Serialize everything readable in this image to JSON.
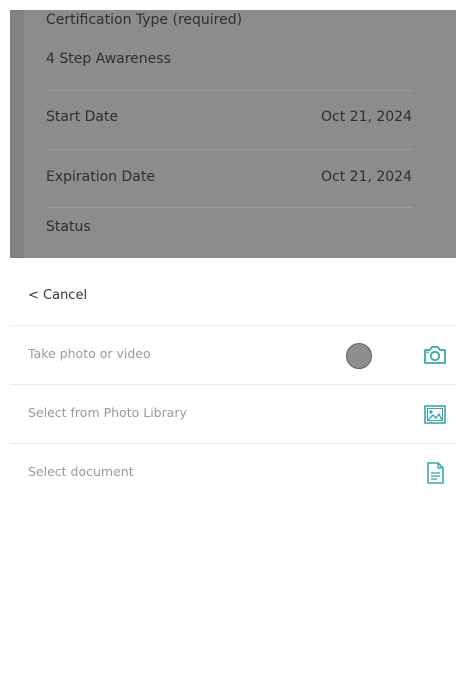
{
  "background_form": {
    "certification_label": "Certification Type (required)",
    "certification_value": "4 Step Awareness",
    "start_date_label": "Start Date",
    "start_date_value": "Oct 21, 2024",
    "expiration_date_label": "Expiration Date",
    "expiration_date_value": "Oct 21, 2024",
    "status_label": "Status"
  },
  "sheet": {
    "cancel_label": "< Cancel",
    "options": [
      {
        "label": "Take photo or video",
        "icon": "camera-icon"
      },
      {
        "label": "Select from Photo Library",
        "icon": "photo-library-icon"
      },
      {
        "label": "Select document",
        "icon": "document-icon"
      }
    ]
  },
  "colors": {
    "backdrop": "#8c8c8c",
    "accent": "#3aa8a8",
    "option_text": "#9a9a9a"
  }
}
